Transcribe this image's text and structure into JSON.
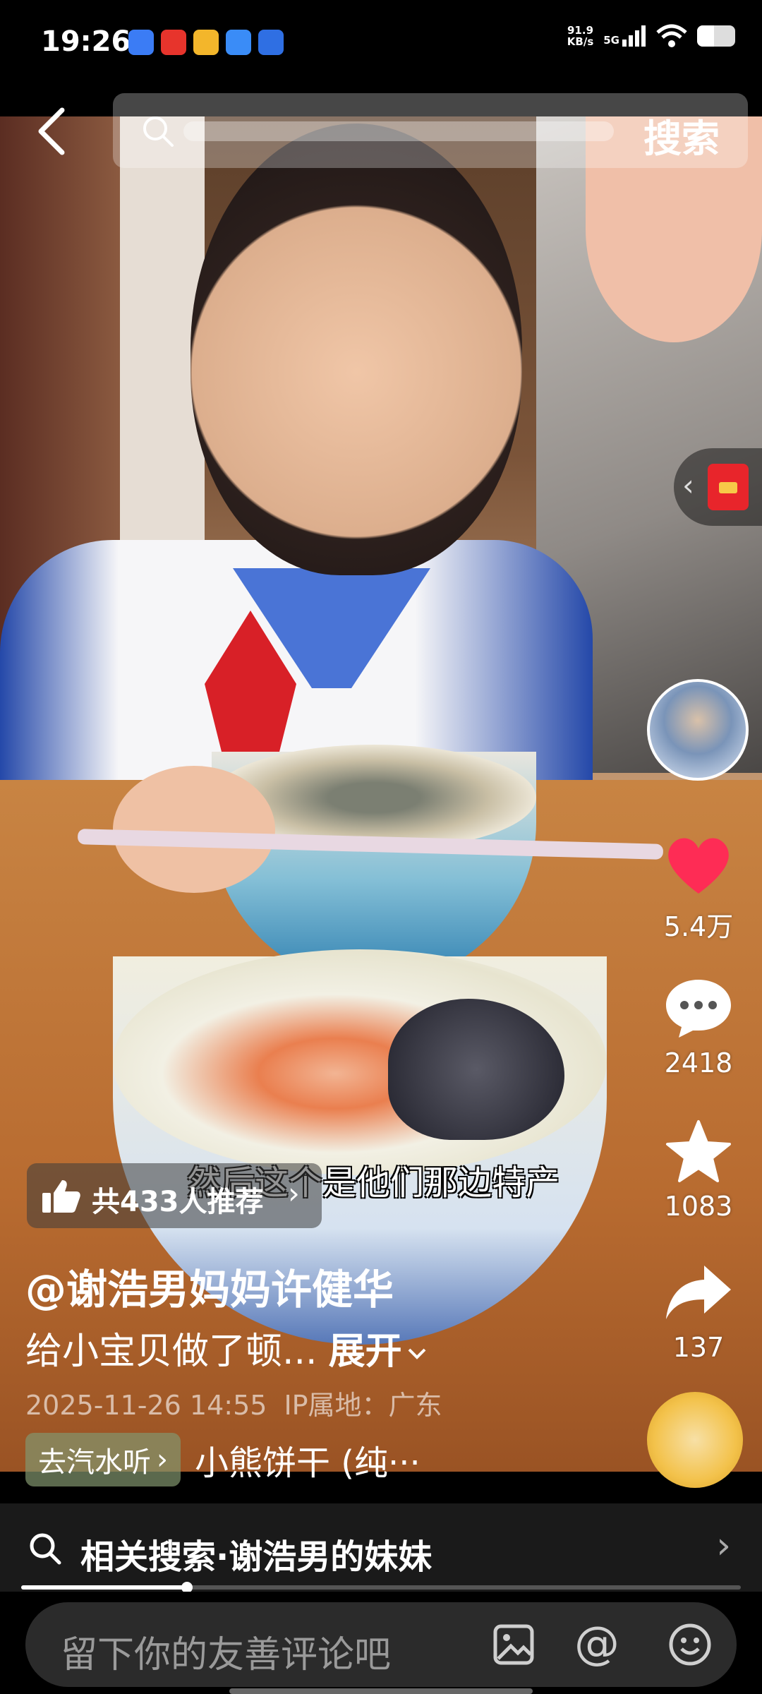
{
  "status_bar": {
    "time": "19:26",
    "net_speed_value": "91.9",
    "net_speed_unit": "KB/s",
    "signal_label": "5G",
    "battery_level": 0.4
  },
  "search": {
    "back_icon": "chevron-left-icon",
    "search_icon": "search-icon",
    "button_label": "搜索"
  },
  "video": {
    "subtitle": "然后这个是他们那边特产"
  },
  "sidebar": {
    "like_count": "5.4万",
    "comment_count": "2418",
    "favorite_count": "1083",
    "share_count": "137"
  },
  "post": {
    "recommend_text": "共433人推荐",
    "author": "@谢浩男妈妈许健华",
    "caption": "给小宝贝做了顿...",
    "expand_label": "展开",
    "timestamp": "2025-11-26 14:55",
    "ip_location": "IP属地：广东",
    "music_tag": "去汽水听",
    "music_name": "小熊饼干 (纯···"
  },
  "related": {
    "label": "相关搜索",
    "separator": "·",
    "query": "谢浩男的妹妹"
  },
  "progress": 0.23,
  "comment_bar": {
    "placeholder": "留下你的友善评论吧",
    "at_label": "@"
  },
  "colors": {
    "like_red": "#fe2c55",
    "redpacket": "#e8252b"
  }
}
